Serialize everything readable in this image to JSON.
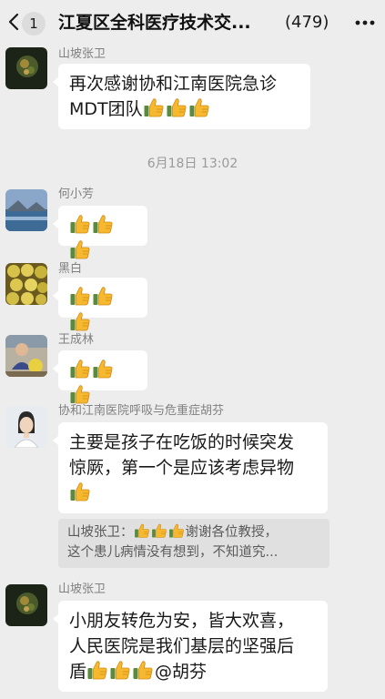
{
  "header": {
    "unread_count": "1",
    "title": "江夏区全科医疗技术交...",
    "member_count": "(479)"
  },
  "timestamp": "6月18日 13:02",
  "messages": [
    {
      "sender": "山坡张卫",
      "text_1": "再次感谢协和江南医院急诊",
      "text_2": "MDT团队",
      "thumbs": 3
    },
    {
      "sender": "何小芳",
      "thumbs": 3
    },
    {
      "sender": "黑白",
      "thumbs": 3
    },
    {
      "sender": "王成林",
      "thumbs": 3
    },
    {
      "sender": "协和江南医院呼吸与危重症胡芬",
      "text_1": "主要是孩子在吃饭的时候突发",
      "text_2": "惊厥，第一个是应该考虑异物",
      "thumbs": 1,
      "quote_sender": "山坡张卫：",
      "quote_line1_text": "谢谢各位教授，",
      "quote_line2": "这个患儿病情没有想到，不知道究..."
    },
    {
      "sender": "山坡张卫",
      "text_1": "小朋友转危为安，皆大欢喜，",
      "text_2": "人民医院是我们基层的坚强后",
      "text_3_prefix": "盾",
      "text_3_suffix": "@胡芬",
      "thumbs": 3
    }
  ],
  "colors": {
    "background": "#ededed",
    "bubble": "#ffffff",
    "quote_bg": "#e0e0e0",
    "thumb": "#f5b82e"
  },
  "icons": [
    "back-chevron-icon",
    "more-icon",
    "thumbs-up-emoji"
  ]
}
